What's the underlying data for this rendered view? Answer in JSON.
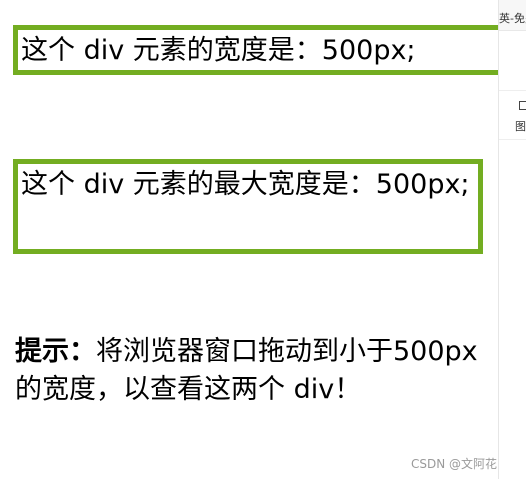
{
  "box_width": {
    "text": "这个 div 元素的宽度是：500px;"
  },
  "box_max_width": {
    "text": "这个 div 元素的最大宽度是：500px;"
  },
  "tip": {
    "label": "提示：",
    "text": "将浏览器窗口拖动到小于500px的宽度，以查看这两个 div！"
  },
  "side_panel": {
    "top_text": "英-免费",
    "icon_label": "图"
  },
  "watermark": "CSDN @文阿花",
  "colors": {
    "border_green": "#73ad21"
  }
}
